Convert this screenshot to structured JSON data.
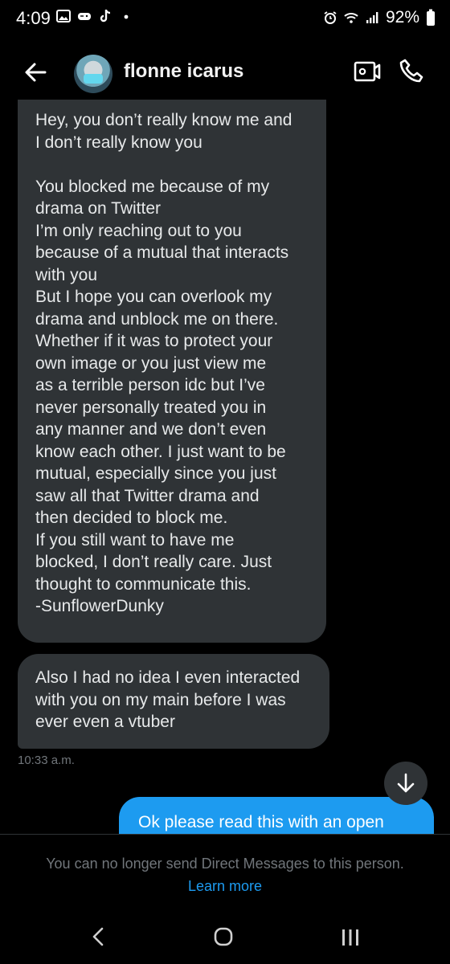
{
  "status_bar": {
    "time": "4:09",
    "battery": "92%",
    "icons": [
      "gallery-icon",
      "gamepad-icon",
      "tiktok-icon",
      "dot-icon",
      "alarm-icon",
      "wifi-icon",
      "signal-icon"
    ]
  },
  "header": {
    "contact_name": "flonne icarus",
    "icons": [
      "back-arrow-icon",
      "video-call-icon",
      "phone-call-icon"
    ]
  },
  "messages": [
    {
      "direction": "incoming",
      "text": "Hey, you don’t really know me and\nI don’t really know you\n\nYou blocked me because of my\ndrama on Twitter\nI’m only reaching out to you\nbecause of a mutual that interacts\nwith you\nBut I hope you can overlook my\ndrama and unblock me on there.\nWhether if it was to protect your\nown image or you just view me\nas a terrible person idc but I’ve\nnever personally treated you in\nany manner and we don’t even\nknow each other. I just want to be\nmutual, especially since you just\nsaw all that Twitter drama and\nthen decided to block me.\nIf you still want to have me\nblocked, I don’t really care. Just\nthought to communicate this.\n-SunflowerDunky"
    },
    {
      "direction": "incoming",
      "text": "Also I had no idea I even interacted\nwith you on my main before I was\never even a vtuber"
    }
  ],
  "timestamp": "10:33 a.m.",
  "outgoing_preview": "Ok please read this with an open",
  "footer": {
    "blocked_notice": "You can no longer send Direct Messages to this person.",
    "learn_more": "Learn more"
  },
  "colors": {
    "background": "#000000",
    "incoming_bubble": "#2f3336",
    "outgoing_bubble": "#1d9bf0",
    "link": "#1d9bf0",
    "muted_text": "#71767b"
  }
}
